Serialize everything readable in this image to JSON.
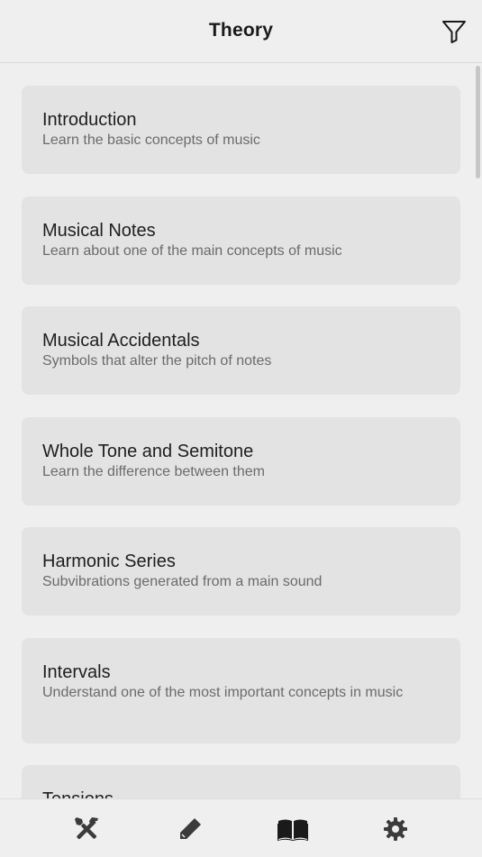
{
  "header": {
    "title": "Theory",
    "filter_icon": "filter-icon"
  },
  "topics": [
    {
      "title": "Introduction",
      "subtitle": "Learn the basic concepts of music"
    },
    {
      "title": "Musical Notes",
      "subtitle": "Learn about one of the main concepts of music"
    },
    {
      "title": "Musical Accidentals",
      "subtitle": "Symbols that alter the pitch of notes"
    },
    {
      "title": "Whole Tone and Semitone",
      "subtitle": "Learn the difference between them"
    },
    {
      "title": "Harmonic Series",
      "subtitle": "Subvibrations generated from a main sound"
    },
    {
      "title": "Intervals",
      "subtitle": "Understand one of the most important concepts in music"
    },
    {
      "title": "Tensions",
      "subtitle": ""
    }
  ],
  "tabbar": {
    "tabs": [
      {
        "icon": "tools-icon"
      },
      {
        "icon": "pencil-icon"
      },
      {
        "icon": "book-icon",
        "active": true
      },
      {
        "icon": "gear-icon"
      }
    ]
  },
  "colors": {
    "background": "#efefef",
    "card": "#e3e3e3",
    "title_text": "#1e1e1e",
    "subtitle_text": "#6b6b6b"
  }
}
